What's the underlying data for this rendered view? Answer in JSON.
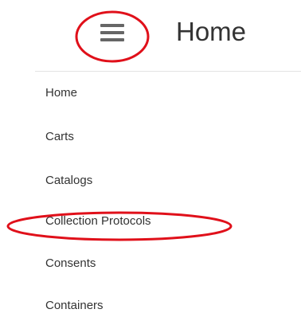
{
  "header": {
    "menu_icon": "hamburger-menu-icon",
    "title": "Home"
  },
  "sidebar": {
    "items": [
      {
        "label": "Home"
      },
      {
        "label": "Carts"
      },
      {
        "label": "Catalogs"
      },
      {
        "label": "Collection Protocols"
      },
      {
        "label": "Consents"
      },
      {
        "label": "Containers"
      }
    ]
  },
  "annotations": {
    "color": "#e0101a",
    "circled": [
      "menu-toggle",
      "Collection Protocols"
    ]
  }
}
